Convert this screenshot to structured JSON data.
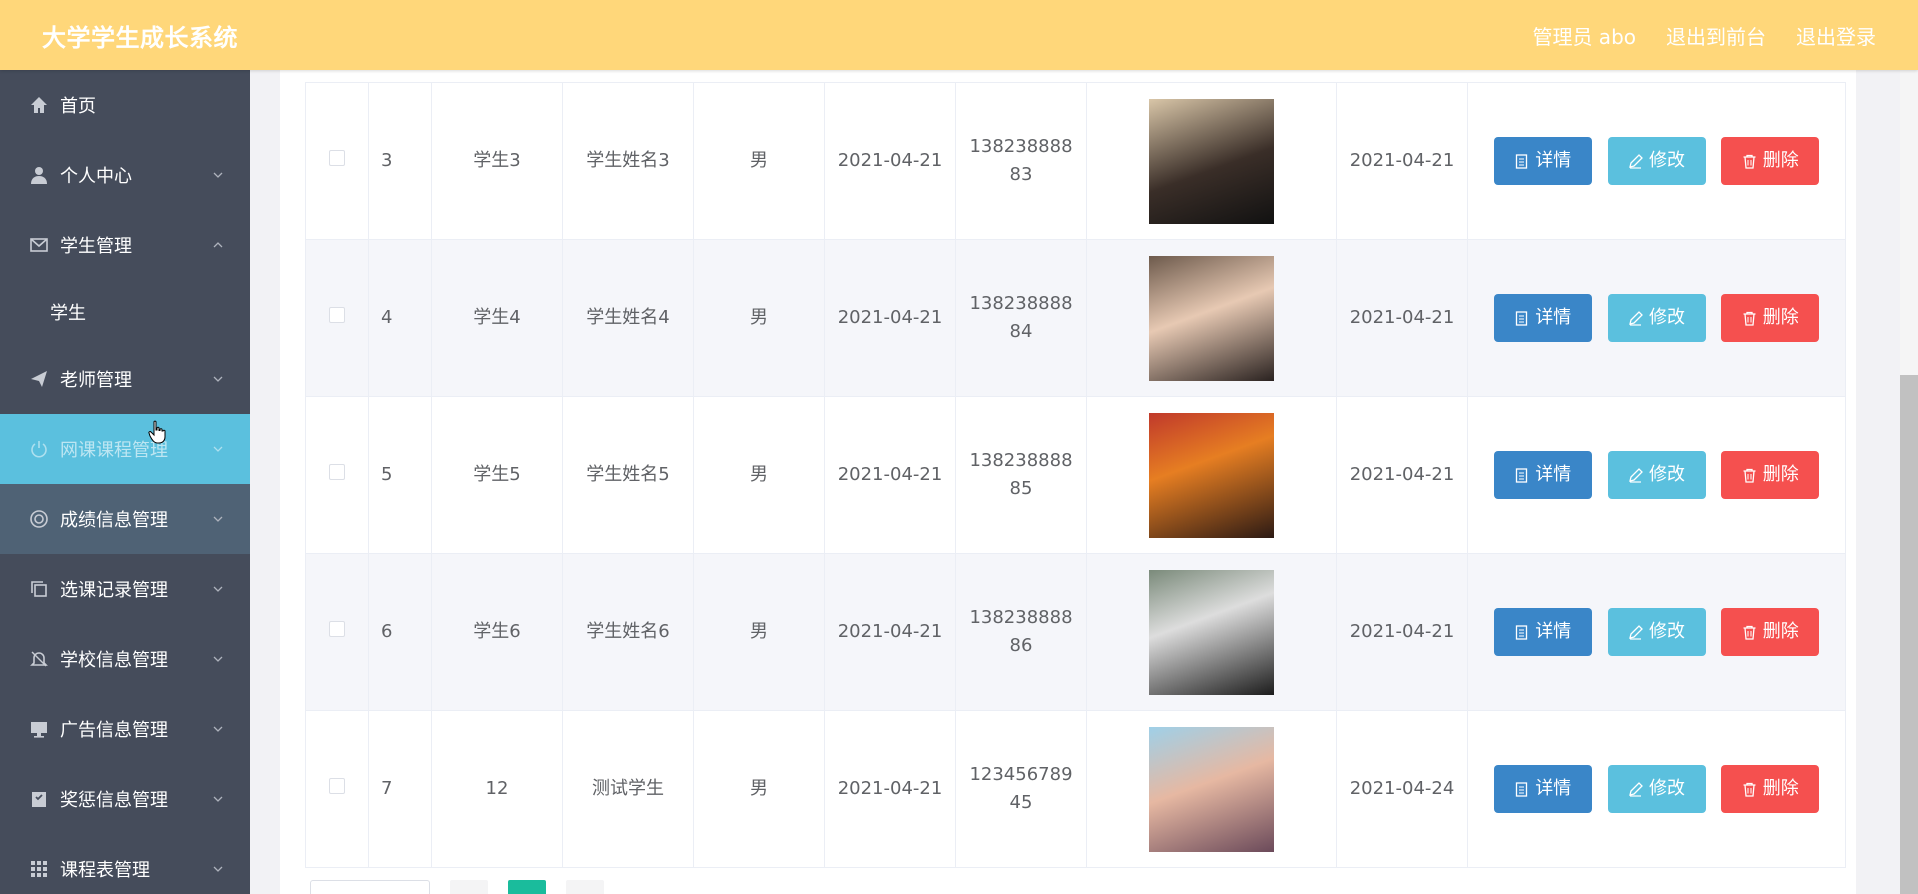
{
  "header": {
    "brand": "大学学生成长系统",
    "user": "管理员 abo",
    "to_front": "退出到前台",
    "logout": "退出登录"
  },
  "sidebar": {
    "items": [
      {
        "label": "首页",
        "icon": "home-icon"
      },
      {
        "label": "个人中心",
        "icon": "user-icon"
      },
      {
        "label": "学生管理",
        "icon": "mail-icon"
      },
      {
        "label": "学生",
        "icon": ""
      },
      {
        "label": "老师管理",
        "icon": "send-icon"
      },
      {
        "label": "网课课程管理",
        "icon": "power-icon"
      },
      {
        "label": "成绩信息管理",
        "icon": "lifebuoy-icon"
      },
      {
        "label": "选课记录管理",
        "icon": "copy-icon"
      },
      {
        "label": "学校信息管理",
        "icon": "bell-icon"
      },
      {
        "label": "广告信息管理",
        "icon": "monitor-icon"
      },
      {
        "label": "奖惩信息管理",
        "icon": "award-icon"
      },
      {
        "label": "课程表管理",
        "icon": "grid-icon"
      }
    ]
  },
  "table": {
    "actions": {
      "detail": "详情",
      "edit": "修改",
      "delete": "删除"
    },
    "rows": [
      {
        "index": "3",
        "account": "学生3",
        "name": "学生姓名3",
        "gender": "男",
        "date1": "2021-04-21",
        "phone": "13823888883",
        "date2": "2021-04-21"
      },
      {
        "index": "4",
        "account": "学生4",
        "name": "学生姓名4",
        "gender": "男",
        "date1": "2021-04-21",
        "phone": "13823888884",
        "date2": "2021-04-21"
      },
      {
        "index": "5",
        "account": "学生5",
        "name": "学生姓名5",
        "gender": "男",
        "date1": "2021-04-21",
        "phone": "13823888885",
        "date2": "2021-04-21"
      },
      {
        "index": "6",
        "account": "学生6",
        "name": "学生姓名6",
        "gender": "男",
        "date1": "2021-04-21",
        "phone": "13823888886",
        "date2": "2021-04-21"
      },
      {
        "index": "7",
        "account": "12",
        "name": "测试学生",
        "gender": "男",
        "date1": "2021-04-21",
        "phone": "12345678945",
        "date2": "2021-04-24"
      }
    ]
  },
  "colors": {
    "header": "#ffd77a",
    "sidebar": "#454c5b",
    "active": "#5bc0de",
    "detail": "#3a86c8",
    "edit": "#5bc0de",
    "delete": "#f5504f"
  }
}
